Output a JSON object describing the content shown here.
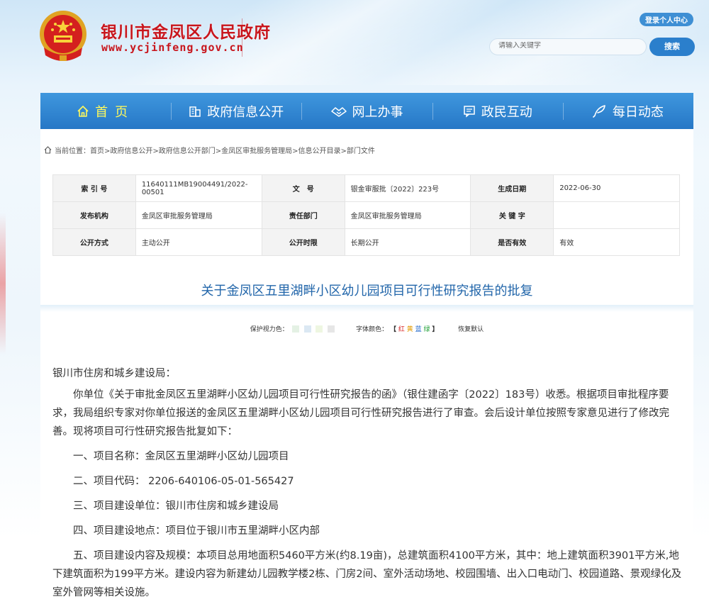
{
  "header": {
    "site_title": "银川市金凤区人民政府",
    "site_url": "www.ycjinfeng.gov.cn",
    "login_label": "登录个人中心",
    "search_placeholder": "请输入关键字",
    "search_button": "搜索"
  },
  "nav": {
    "items": [
      {
        "label": "首页",
        "icon": "home-icon"
      },
      {
        "label": "政府信息公开",
        "icon": "building-icon"
      },
      {
        "label": "网上办事",
        "icon": "handshake-icon"
      },
      {
        "label": "政民互动",
        "icon": "message-icon"
      },
      {
        "label": "每日动态",
        "icon": "feather-icon"
      }
    ]
  },
  "breadcrumb": {
    "text": "当前位置：首页>政府信息公开>政府信息公开部门>金凤区审批服务管理局>信息公开目录>部门文件"
  },
  "meta": {
    "index_no_label": "索 引 号",
    "index_no": "11640111MB19004491/2022-00501",
    "doc_no_label": "文　号",
    "doc_no": "银金审服批〔2022〕223号",
    "date_label": "生成日期",
    "date": "2022-06-30",
    "publisher_label": "发布机构",
    "publisher": "金凤区审批服务管理局",
    "dept_label": "责任部门",
    "dept": "金凤区审批服务管理局",
    "keywords_label": "关 键 字",
    "keywords": "",
    "method_label": "公开方式",
    "method": "主动公开",
    "period_label": "公开时限",
    "period": "长期公开",
    "valid_label": "是否有效",
    "valid": "有效"
  },
  "document": {
    "title": "关于金凤区五里湖畔小区幼儿园项目可行性研究报告的批复"
  },
  "tools": {
    "eye_label": "保护视力色：",
    "font_color_label": "字体颜色：",
    "bracket_open": "【",
    "bracket_close": "】",
    "red": "红",
    "yellow": "黄",
    "blue": "蓝",
    "green": "绿",
    "reset": "恢复默认",
    "swatch_colors": [
      "#e4f1e4",
      "#dbe8f3",
      "#eef6e1",
      "#e6e6e6"
    ]
  },
  "body": {
    "salutation": "银川市住房和城乡建设局：",
    "para1": "你单位《关于审批金凤区五里湖畔小区幼儿园项目可行性研究报告的函》（银住建函字〔2022〕183号）收悉。根据项目审批程序要求，我局组织专家对你单位报送的金凤区五里湖畔小区幼儿园项目可行性研究报告进行了审查。会后设计单位按照专家意见进行了修改完善。现将项目可行性研究报告批复如下：",
    "item1": "一、项目名称：金凤区五里湖畔小区幼儿园项目",
    "item2": "二、项目代码： 2206-640106-05-01-565427",
    "item3": "三、项目建设单位：银川市住房和城乡建设局",
    "item4": "四、项目建设地点：项目位于银川市五里湖畔小区内部",
    "item5": "五、项目建设内容及规模：本项目总用地面积5460平方米(约8.19亩)，总建筑面积4100平方米，其中：地上建筑面积3901平方米,地下建筑面积为199平方米。建设内容为新建幼儿园教学楼2栋、门房2间、室外活动场地、校园围墙、出入口电动门、校园道路、景观绿化及室外管网等相关设施。"
  },
  "colors": {
    "nav_blue": "#2b82d0",
    "brand_red": "#c8161d",
    "home_highlight": "#fff95c",
    "title_blue": "#2266aa"
  }
}
